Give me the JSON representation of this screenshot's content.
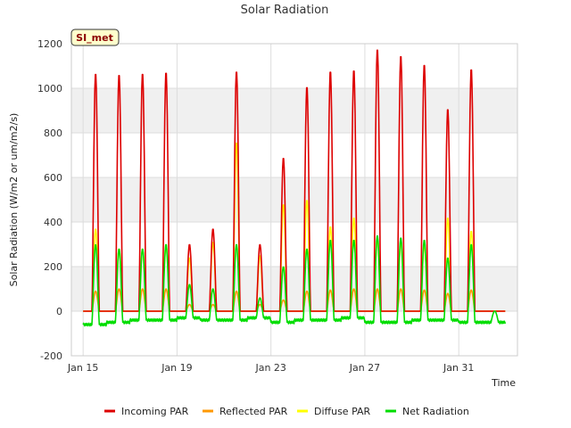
{
  "chart_data": {
    "type": "line",
    "title": "Solar Radiation",
    "xlabel": "Time",
    "ylabel": "Solar Radiation (W/m2 or um/m2/s)",
    "station_label": "SI_met",
    "ylim": [
      -200,
      1200
    ],
    "xlim_days": [
      14.5,
      33.5
    ],
    "y_ticks": [
      -200,
      0,
      200,
      400,
      600,
      800,
      1000,
      1200
    ],
    "x_ticks": [
      {
        "day": 15,
        "label": "Jan 15"
      },
      {
        "day": 19,
        "label": "Jan 19"
      },
      {
        "day": 23,
        "label": "Jan 23"
      },
      {
        "day": 27,
        "label": "Jan 27"
      },
      {
        "day": 31,
        "label": "Jan 31"
      }
    ],
    "grid": true,
    "legend_position": "bottom",
    "daily_peaks": {
      "days": [
        "Jan 15",
        "Jan 16",
        "Jan 17",
        "Jan 18",
        "Jan 19",
        "Jan 20",
        "Jan 21",
        "Jan 22",
        "Jan 23",
        "Jan 24",
        "Jan 25",
        "Jan 26",
        "Jan 27",
        "Jan 28",
        "Jan 29",
        "Jan 30",
        "Jan 31",
        "Jan 32"
      ],
      "series": [
        {
          "name": "Incoming PAR",
          "color": "#dd0000",
          "values": [
            1070,
            1065,
            1070,
            1075,
            300,
            370,
            1080,
            300,
            690,
            1010,
            1080,
            1085,
            1180,
            1150,
            1110,
            910,
            1090,
            0
          ]
        },
        {
          "name": "Reflected PAR",
          "color": "#ff9900",
          "values": [
            90,
            100,
            100,
            100,
            30,
            30,
            90,
            30,
            50,
            90,
            95,
            100,
            100,
            100,
            95,
            80,
            95,
            0
          ]
        },
        {
          "name": "Diffuse PAR",
          "color": "#ffff00",
          "values": [
            370,
            280,
            280,
            300,
            240,
            310,
            760,
            250,
            480,
            500,
            380,
            420,
            330,
            310,
            300,
            420,
            360,
            0
          ]
        },
        {
          "name": "Net Radiation",
          "color": "#00dd00",
          "values": [
            300,
            280,
            280,
            300,
            120,
            100,
            300,
            60,
            200,
            280,
            320,
            320,
            340,
            330,
            320,
            240,
            300,
            0
          ]
        }
      ],
      "net_night_values": [
        -60,
        -50,
        -40,
        -40,
        -30,
        -40,
        -40,
        -30,
        -50,
        -40,
        -40,
        -30,
        -50,
        -50,
        -40,
        -40,
        -50,
        -50
      ]
    }
  }
}
